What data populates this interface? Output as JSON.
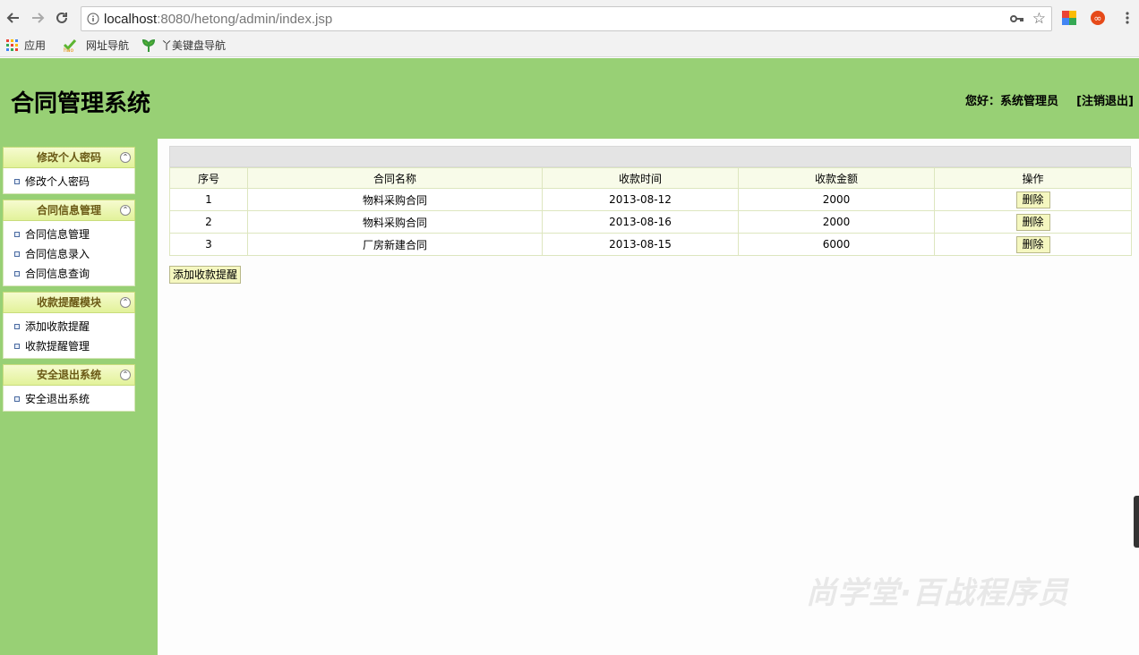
{
  "browser": {
    "url_host": "localhost",
    "url_rest": ":8080/hetong/admin/index.jsp",
    "bookmarks": [
      "应用",
      "网址导航",
      "丫美键盘导航"
    ]
  },
  "header": {
    "title": "合同管理系统",
    "user_greeting": "您好：系统管理员",
    "logout": "[注销退出]"
  },
  "sidebar": {
    "groups": [
      {
        "title": "修改个人密码",
        "items": [
          "修改个人密码"
        ]
      },
      {
        "title": "合同信息管理",
        "items": [
          "合同信息管理",
          "合同信息录入",
          "合同信息查询"
        ]
      },
      {
        "title": "收款提醒模块",
        "items": [
          "添加收款提醒",
          "收款提醒管理"
        ]
      },
      {
        "title": "安全退出系统",
        "items": [
          "安全退出系统"
        ]
      }
    ]
  },
  "table": {
    "headers": [
      "序号",
      "合同名称",
      "收款时间",
      "收款金额",
      "操作"
    ],
    "rows": [
      {
        "no": "1",
        "name": "物料采购合同",
        "date": "2013-08-12",
        "amount": "2000",
        "action": "删除"
      },
      {
        "no": "2",
        "name": "物料采购合同",
        "date": "2013-08-16",
        "amount": "2000",
        "action": "删除"
      },
      {
        "no": "3",
        "name": "厂房新建合同",
        "date": "2013-08-15",
        "amount": "6000",
        "action": "删除"
      }
    ]
  },
  "add_button": "添加收款提醒",
  "watermark": "尚学堂·百战程序员",
  "colors": {
    "page_bg": "#98d075",
    "menu_head": "#e2f29a",
    "button_bg": "#f5f7c0"
  }
}
